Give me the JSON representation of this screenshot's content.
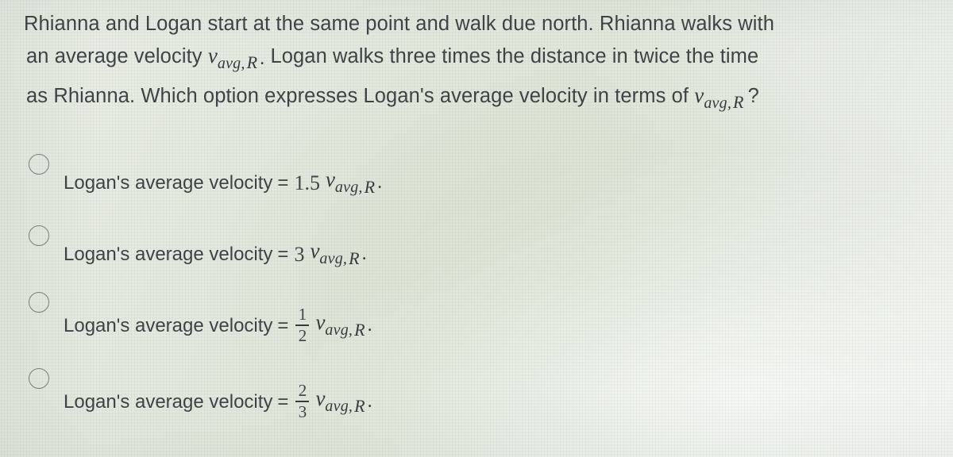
{
  "page": {
    "type": "multiple-choice-physics-question",
    "background_color": "#e8ece4",
    "text_color": "#3c4448",
    "radio_outline_color": "#77807f"
  },
  "question": {
    "line1": "Rhianna and Logan start at the same point and walk due north. Rhianna walks with",
    "line2_a": "an average velocity",
    "line2_b": "Logan walks three times the distance in twice the time",
    "line3_a": "as Rhianna.  Which option expresses Logan's average velocity in terms of",
    "question_mark": "?"
  },
  "math": {
    "variable": "v",
    "subscript": "avg,",
    "subscript_r": "R",
    "period": "."
  },
  "options": [
    {
      "id": "option-1",
      "label": "Logan's average velocity",
      "equals": "=",
      "coefficient": "1.5",
      "coefficient_type": "decimal",
      "variable": "v",
      "subscript": "avg,",
      "subscript_r": "R",
      "trailing": ".",
      "selected": false
    },
    {
      "id": "option-2",
      "label": "Logan's average velocity",
      "equals": "=",
      "coefficient": "3",
      "coefficient_type": "integer",
      "variable": "v",
      "subscript": "avg,",
      "subscript_r": "R",
      "trailing": ".",
      "selected": false
    },
    {
      "id": "option-3",
      "label": "Logan's average velocity",
      "equals": "=",
      "coefficient_type": "fraction",
      "numerator": "1",
      "denominator": "2",
      "variable": "v",
      "subscript": "avg,",
      "subscript_r": "R",
      "trailing": ".",
      "selected": false
    },
    {
      "id": "option-4",
      "label": "Logan's average velocity",
      "equals": "=",
      "coefficient_type": "fraction",
      "numerator": "2",
      "denominator": "3",
      "variable": "v",
      "subscript": "avg,",
      "subscript_r": "R",
      "trailing": ".",
      "selected": false
    }
  ]
}
